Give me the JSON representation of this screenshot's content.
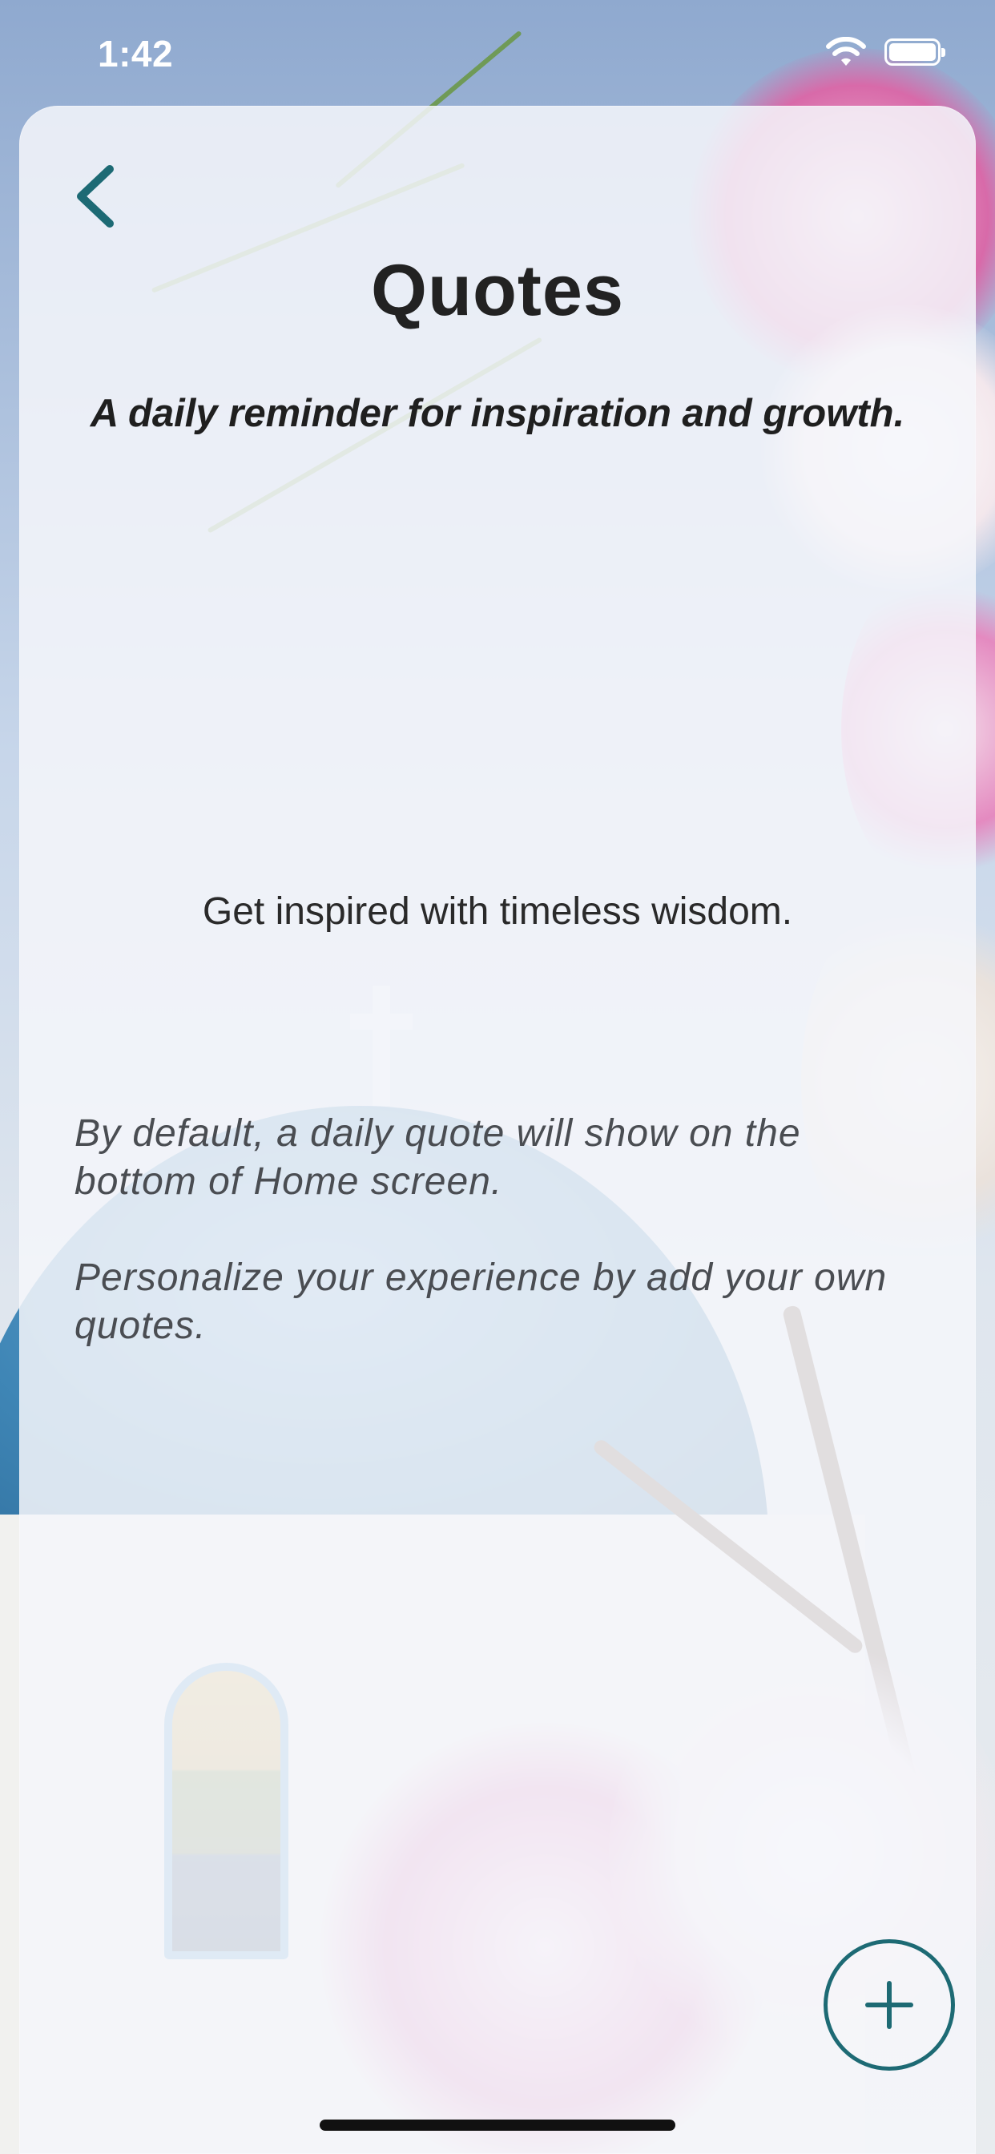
{
  "status_bar": {
    "time": "1:42",
    "icons": [
      "wifi-icon",
      "battery-icon"
    ]
  },
  "nav": {
    "back_icon": "chevron-left-icon",
    "back_color": "#1d6a74"
  },
  "header": {
    "title": "Quotes",
    "subtitle": "A daily reminder for inspiration and growth."
  },
  "main": {
    "headline": "Get inspired with timeless wisdom.",
    "paragraphs": [
      "By default, a daily quote will show on the bottom of Home screen.",
      "Personalize your experience by add your own quotes."
    ]
  },
  "fab": {
    "icon": "plus-icon",
    "color": "#1d6a74"
  }
}
